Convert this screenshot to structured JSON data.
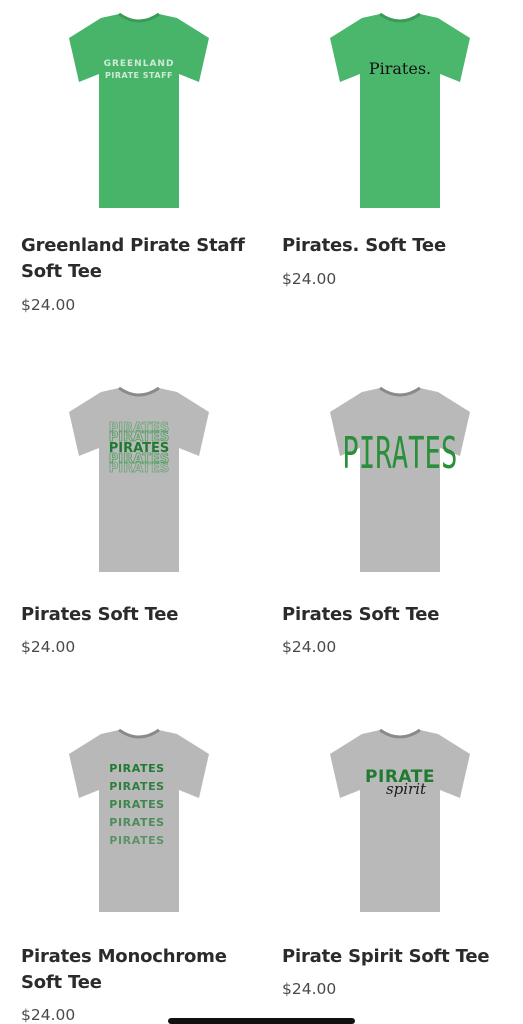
{
  "products": [
    {
      "title": "Greenland Pirate Staff Soft Tee",
      "price": "$24.00",
      "shirt_color": "#47b46a",
      "print": [
        "GREENLAND",
        "PIRATE STAFF"
      ],
      "print_color": "#cfe9d6"
    },
    {
      "title": "Pirates. Soft Tee",
      "price": "$24.00",
      "shirt_color": "#4ab76c",
      "print": [
        "Pirates."
      ],
      "print_color": "#111111"
    },
    {
      "title": "Pirates Soft Tee",
      "price": "$24.00",
      "shirt_color": "#b9b9b9",
      "print": [
        "PIRATES"
      ],
      "print_color": "#1f7a32"
    },
    {
      "title": "Pirates Soft Tee",
      "price": "$24.00",
      "shirt_color": "#b9b9b9",
      "print": [
        "PIRATES"
      ],
      "print_color": "#2a8f3a"
    },
    {
      "title": "Pirates Monochrome Soft Tee",
      "price": "$24.00",
      "shirt_color": "#b8b8b8",
      "print": [
        "PIRATES",
        "PIRATES",
        "PIRATES",
        "PIRATES",
        "PIRATES"
      ],
      "print_color": "#1f7a32"
    },
    {
      "title": "Pirate Spirit Soft Tee",
      "price": "$24.00",
      "shirt_color": "#b9b9b9",
      "print": [
        "PIRATE",
        "spirit"
      ],
      "print_color": "#1f7a32"
    }
  ]
}
